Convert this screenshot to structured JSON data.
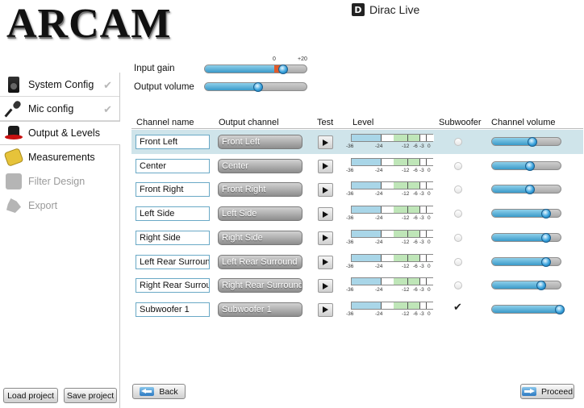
{
  "header": {
    "logo": "ARCAM",
    "brand": "Dirac Live",
    "brand_mark": "D"
  },
  "sidebar": {
    "items": [
      {
        "label": "System Config",
        "icon": "speaker-icon",
        "state": "done"
      },
      {
        "label": "Mic config",
        "icon": "microphone-icon",
        "state": "done"
      },
      {
        "label": "Output & Levels",
        "icon": "hat-icon",
        "state": "active"
      },
      {
        "label": "Measurements",
        "icon": "tape-measure-icon",
        "state": "enabled"
      },
      {
        "label": "Filter Design",
        "icon": "filter-icon",
        "state": "disabled"
      },
      {
        "label": "Export",
        "icon": "export-icon",
        "state": "disabled"
      }
    ],
    "check_glyph": "✔",
    "load_project": "Load project",
    "save_project": "Save project"
  },
  "controls": {
    "input_gain_label": "Input gain",
    "input_gain_tick_0": "0",
    "input_gain_tick_max": "+20",
    "input_gain_level": 0.77,
    "output_volume_label": "Output volume",
    "output_volume_level": 0.52
  },
  "table": {
    "headers": {
      "channel_name": "Channel name",
      "output_channel": "Output channel",
      "test": "Test",
      "level": "Level",
      "subwoofer": "Subwoofer",
      "channel_volume": "Channel volume"
    },
    "meter_ticks": [
      "-36",
      "-24",
      "-12",
      "-6",
      "-3",
      "0"
    ],
    "rows": [
      {
        "name": "Front Left",
        "output": "Front Left",
        "subwoofer": false,
        "volume": 0.6,
        "selected": true
      },
      {
        "name": "Center",
        "output": "Center",
        "subwoofer": false,
        "volume": 0.56,
        "selected": false
      },
      {
        "name": "Front Right",
        "output": "Front Right",
        "subwoofer": false,
        "volume": 0.56,
        "selected": false
      },
      {
        "name": "Left Side",
        "output": "Left Side",
        "subwoofer": false,
        "volume": 0.8,
        "selected": false
      },
      {
        "name": "Right Side",
        "output": "Right Side",
        "subwoofer": false,
        "volume": 0.8,
        "selected": false
      },
      {
        "name": "Left Rear Surround",
        "output": "Left Rear Surround",
        "subwoofer": false,
        "volume": 0.8,
        "selected": false
      },
      {
        "name": "Right Rear Surround",
        "output": "Right Rear Surround",
        "subwoofer": false,
        "volume": 0.73,
        "selected": false
      },
      {
        "name": "Subwoofer 1",
        "output": "Subwoofer 1",
        "subwoofer": true,
        "volume": 1.0,
        "selected": false
      }
    ]
  },
  "footer": {
    "back_label": "Back",
    "proceed_label": "Proceed"
  },
  "colors": {
    "selected_row": "#cfe4ea",
    "slider_fill": "#3a9ac9",
    "gain_marker": "#e25a2a"
  }
}
